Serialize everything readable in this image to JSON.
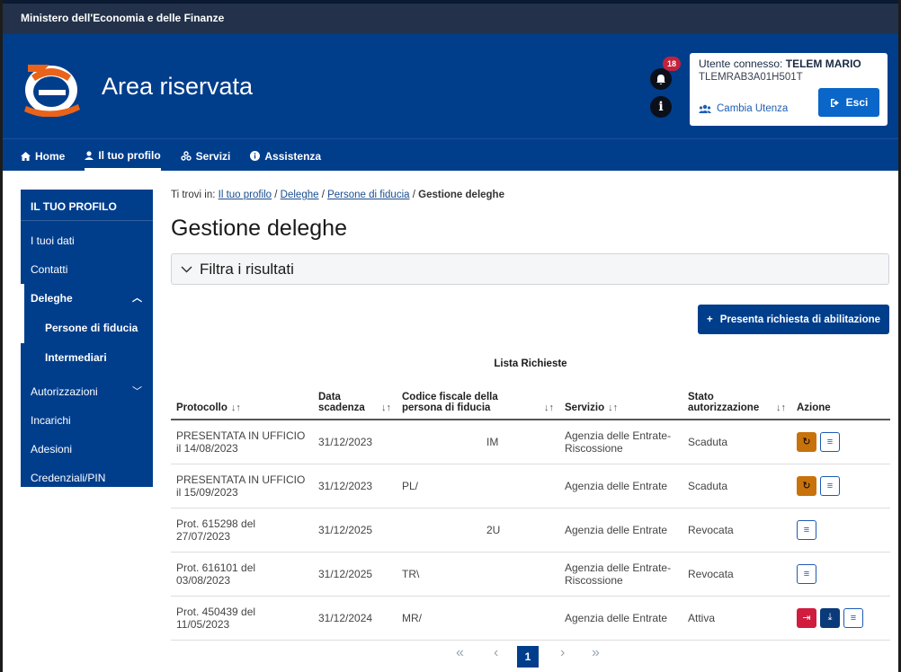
{
  "ministry": "Ministero dell'Economia e delle Finanze",
  "brand": "Area riservata",
  "notifications_count": "18",
  "user": {
    "connected_label": "Utente connesso:",
    "name": "TELEM MARIO",
    "fiscal_code": "TLEMRAB3A01H501T",
    "switch_label": "Cambia Utenza",
    "logout_label": "Esci"
  },
  "nav": [
    {
      "label": "Home",
      "icon": "home-icon"
    },
    {
      "label": "Il tuo profilo",
      "icon": "user-icon"
    },
    {
      "label": "Servizi",
      "icon": "services-icon"
    },
    {
      "label": "Assistenza",
      "icon": "info-icon"
    }
  ],
  "sidebar": {
    "title": "IL TUO PROFILO",
    "items": [
      "I tuoi dati",
      "Contatti",
      "Deleghe",
      "Persone di fiducia",
      "Intermediari",
      "Autorizzazioni",
      "Incarichi",
      "Adesioni",
      "Credenziali/PIN"
    ]
  },
  "breadcrumb": {
    "prefix": "Ti trovi in:",
    "links": [
      "Il tuo profilo",
      "Deleghe",
      "Persone di fiducia"
    ],
    "current": "Gestione deleghe"
  },
  "page_title": "Gestione deleghe",
  "filter_label": "Filtra i risultati",
  "present_button": "Presenta richiesta di abilitazione",
  "table": {
    "caption": "Lista Richieste",
    "headers": {
      "protocollo": "Protocollo",
      "data": "Data scadenza",
      "codice": "Codice fiscale della persona di fiducia",
      "servizio": "Servizio",
      "stato": "Stato autorizzazione",
      "azione": "Azione"
    },
    "rows": [
      {
        "protocollo": "PRESENTATA IN UFFICIO il 14/08/2023",
        "data": "31/12/2023",
        "codice": "IM",
        "servizio": "Agenzia delle Entrate-Riscossione",
        "stato": "Scaduta"
      },
      {
        "protocollo": "PRESENTATA IN UFFICIO il 15/09/2023",
        "data": "31/12/2023",
        "codice": "PL/",
        "servizio": "Agenzia delle Entrate",
        "stato": "Scaduta"
      },
      {
        "protocollo": "Prot. 615298 del 27/07/2023",
        "data": "31/12/2025",
        "codice": "2U",
        "servizio": "Agenzia delle Entrate",
        "stato": "Revocata"
      },
      {
        "protocollo": "Prot. 616101 del 03/08/2023",
        "data": "31/12/2025",
        "codice": "TR\\",
        "servizio": "Agenzia delle Entrate-Riscossione",
        "stato": "Revocata"
      },
      {
        "protocollo": "Prot. 450439 del 11/05/2023",
        "data": "31/12/2024",
        "codice": "MR/",
        "servizio": "Agenzia delle Entrate",
        "stato": "Attiva"
      }
    ]
  },
  "pagination": {
    "first": "«",
    "prev": "‹",
    "current": "1",
    "next": "›",
    "last": "»"
  },
  "colors": {
    "brand_blue": "#003e8c",
    "warning_orange": "#c8720c",
    "danger_red": "#d01c3d"
  }
}
